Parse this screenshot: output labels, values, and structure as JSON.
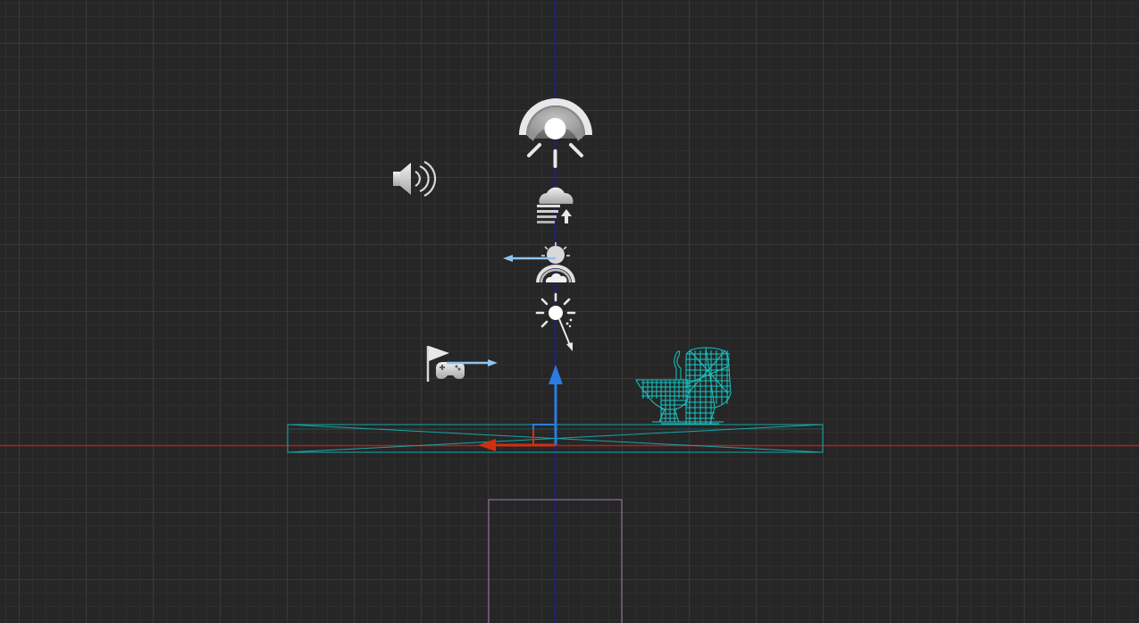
{
  "viewport": {
    "view": "orthographic-side",
    "background_color": "#262626",
    "grid": {
      "visible": true,
      "minor_color": "#2e2e2e",
      "major_color": "#3a3a3a"
    },
    "axis_colors": {
      "x": "#b41e1e",
      "z": "#1a1ab0"
    }
  },
  "actors": [
    {
      "name": "sky-light",
      "icon": "sky-light-icon"
    },
    {
      "name": "ambient-sound",
      "icon": "speaker-icon"
    },
    {
      "name": "exponential-height-fog",
      "icon": "fog-icon"
    },
    {
      "name": "sky-atmosphere",
      "icon": "sky-atmosphere-icon"
    },
    {
      "name": "directional-light",
      "icon": "sun-light-icon"
    },
    {
      "name": "player-start",
      "icon": "player-start-icon"
    },
    {
      "name": "floor-mesh",
      "wireframe_color": "#1aa5a5"
    },
    {
      "name": "toilet-mesh",
      "wireframe_color": "#16c8c8"
    },
    {
      "name": "selection-volume",
      "color": "#9c7ca8"
    }
  ],
  "gizmo": {
    "type": "translate",
    "colors": {
      "x": "#d03010",
      "z": "#2a7ce0",
      "arrow": "#8ec4f0"
    }
  }
}
